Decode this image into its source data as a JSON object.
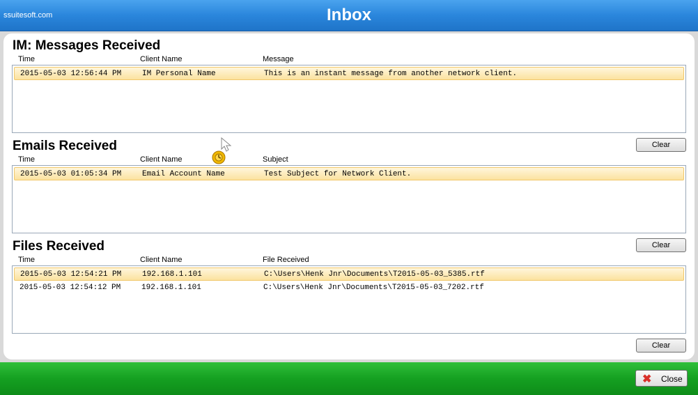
{
  "window": {
    "brand": "ssuitesoft.com",
    "title": "Inbox"
  },
  "im": {
    "title": "IM: Messages Received",
    "headers": [
      "Time",
      "Client Name",
      "Message"
    ],
    "rows": [
      {
        "time": "2015-05-03 12:56:44 PM",
        "client": "IM Personal Name",
        "value": "This is an instant message from another network client."
      }
    ]
  },
  "emails": {
    "title": "Emails Received",
    "headers": [
      "Time",
      "Client Name",
      "Subject"
    ],
    "clear_label": "Clear",
    "rows": [
      {
        "time": "2015-05-03 01:05:34 PM",
        "client": "Email Account Name",
        "value": "Test Subject for Network Client."
      }
    ]
  },
  "files": {
    "title": "Files Received",
    "headers": [
      "Time",
      "Client Name",
      "File Received"
    ],
    "clear_label": "Clear",
    "rows": [
      {
        "time": "2015-05-03 12:54:21 PM",
        "client": "192.168.1.101",
        "value": "C:\\Users\\Henk Jnr\\Documents\\T2015-05-03_5385.rtf"
      },
      {
        "time": "2015-05-03 12:54:12 PM",
        "client": "192.168.1.101",
        "value": "C:\\Users\\Henk Jnr\\Documents\\T2015-05-03_7202.rtf"
      }
    ]
  },
  "bottom_clear_label": "Clear",
  "footer": {
    "close_label": "Close",
    "close_icon": "red-x-icon"
  },
  "colors": {
    "title_bar": "#2a86dc",
    "footer": "#15a021",
    "selection": "#fbe29f"
  }
}
